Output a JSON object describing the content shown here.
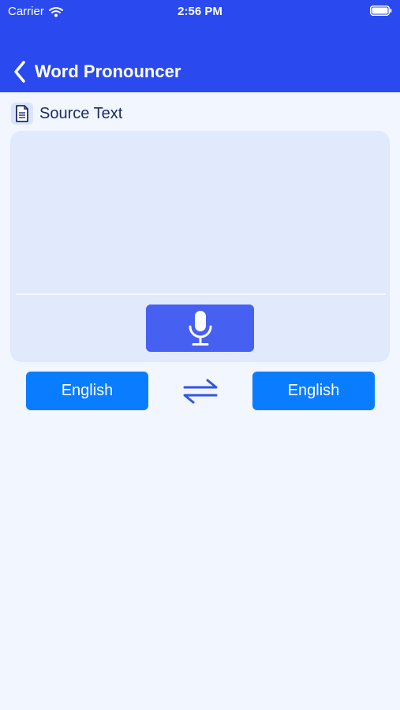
{
  "status_bar": {
    "carrier": "Carrier",
    "time": "2:56 PM"
  },
  "nav": {
    "title": "Word Pronouncer",
    "back_icon": "chevron-left-icon"
  },
  "source": {
    "label": "Source Text",
    "icon": "document-icon",
    "input_value": "",
    "input_placeholder": ""
  },
  "mic": {
    "icon": "microphone-icon"
  },
  "languages": {
    "source": "English",
    "target": "English",
    "swap_icon": "swap-arrows-icon"
  },
  "colors": {
    "header": "#2A4AF0",
    "background": "#F2F6FE",
    "card": "#E1E9FC",
    "mic_button": "#4661F2",
    "language_button": "#0A7CFF",
    "label_text": "#1E2A66"
  }
}
